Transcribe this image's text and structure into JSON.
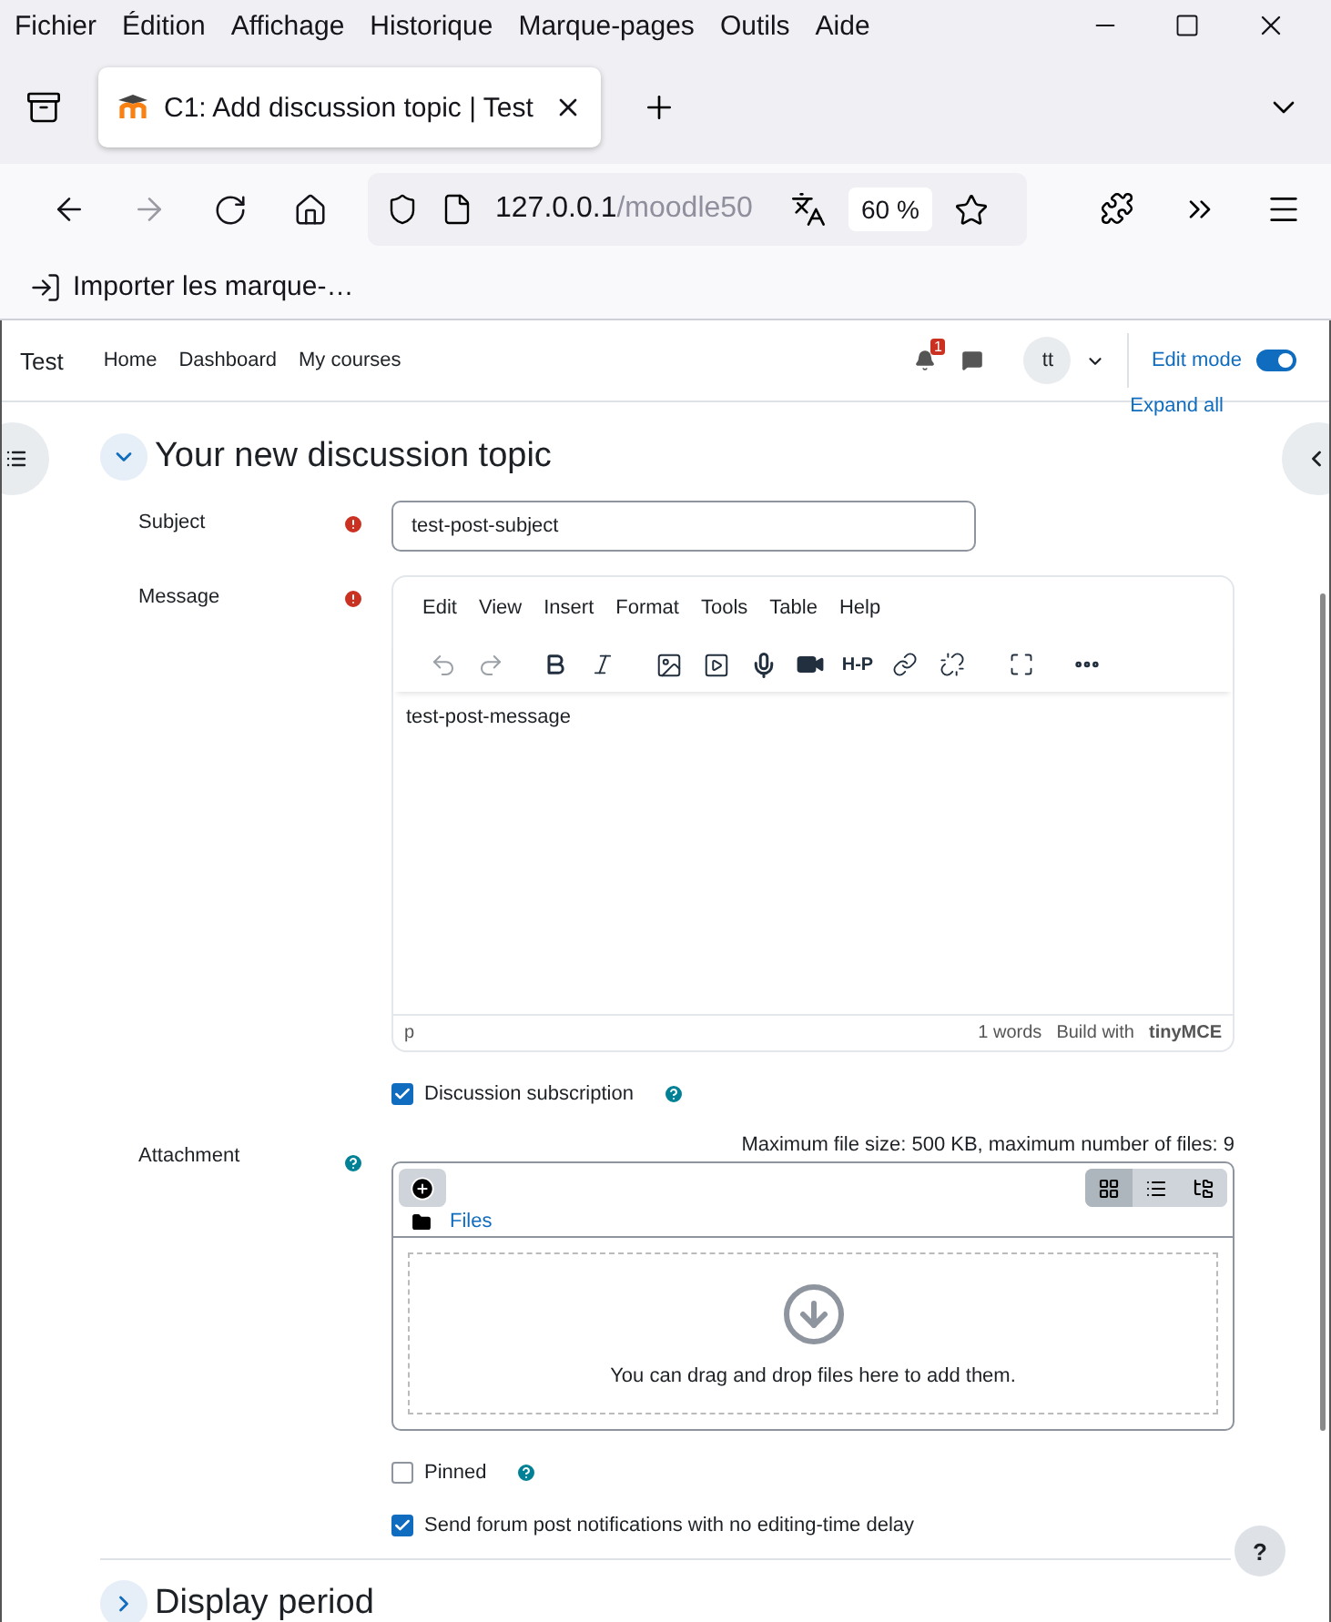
{
  "menu_bar": [
    "Fichier",
    "Édition",
    "Affichage",
    "Historique",
    "Marque-pages",
    "Outils",
    "Aide"
  ],
  "tabs": [
    {
      "title": "C1: Add discussion topic | Test",
      "selected": true
    }
  ],
  "address_bar": {
    "host": "127.0.0.1",
    "path": "/moodle50",
    "zoom": "60 %"
  },
  "bookmarks": [
    {
      "label": "Importer les marque-…"
    }
  ],
  "site_nav": {
    "site_name": "Test",
    "links": [
      {
        "label": "Home"
      },
      {
        "label": "Dashboard"
      },
      {
        "label": "My courses"
      }
    ],
    "notification_count": "1",
    "avatar": "tt",
    "edit_mode": {
      "label": "Edit mode",
      "on": true
    }
  },
  "expand_all": "Expand all",
  "sections": [
    {
      "title": "Your new discussion topic",
      "expanded": true,
      "fields": [
        {
          "kind": "text",
          "label": "Subject",
          "required": true,
          "help": false,
          "value": "test-post-subject"
        },
        {
          "kind": "editor",
          "label": "Message",
          "required": true,
          "help": false,
          "menu": [
            "Edit",
            "View",
            "Insert",
            "Format",
            "Tools",
            "Table",
            "Help"
          ],
          "h5p_label": "H-P",
          "content": "test-post-message",
          "path": "p",
          "word_count": "1 words",
          "branding": "Build with",
          "brand": "tinyMCE"
        },
        {
          "kind": "checkbox",
          "label": "Discussion subscription",
          "required": false,
          "help": true,
          "checked": true
        },
        {
          "kind": "filepicker",
          "label": "Attachment",
          "required": false,
          "help": true,
          "limits": "Maximum file size: 500 KB, maximum number of files: 9",
          "folder": "Files",
          "drop_hint": "You can drag and drop files here to add them.",
          "view_modes": [
            {
              "selected": true
            },
            {
              "selected": false
            },
            {
              "selected": false
            }
          ]
        },
        {
          "kind": "checkbox",
          "label": "Pinned",
          "required": false,
          "help": true,
          "checked": false
        },
        {
          "kind": "checkbox",
          "label": "Send forum post notifications with no editing-time delay",
          "required": false,
          "help": false,
          "checked": true
        }
      ]
    },
    {
      "title": "Display period",
      "expanded": false
    }
  ],
  "help_button": "?"
}
